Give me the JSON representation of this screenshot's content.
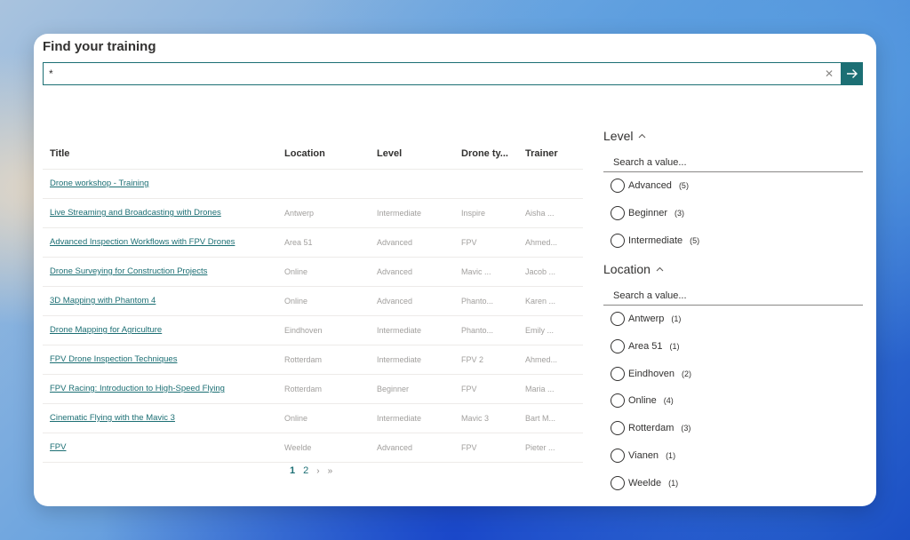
{
  "header": {
    "title": "Find your training"
  },
  "search": {
    "value": "*",
    "clear_glyph": "✕",
    "submit_icon": "arrow-right-icon"
  },
  "table": {
    "columns": [
      "Title",
      "Location",
      "Level",
      "Drone ty...",
      "Trainer"
    ],
    "rows": [
      {
        "title": "Drone workshop - Training",
        "location": "",
        "level": "",
        "drone": "",
        "trainer": ""
      },
      {
        "title": "Live Streaming and Broadcasting with Drones",
        "location": "Antwerp",
        "level": "Intermediate",
        "drone": "Inspire",
        "trainer": "Aisha ..."
      },
      {
        "title": "Advanced Inspection Workflows with FPV Drones",
        "location": "Area 51",
        "level": "Advanced",
        "drone": "FPV",
        "trainer": "Ahmed..."
      },
      {
        "title": "Drone Surveying for Construction Projects",
        "location": "Online",
        "level": "Advanced",
        "drone": "Mavic ...",
        "trainer": "Jacob ..."
      },
      {
        "title": "3D Mapping with Phantom 4",
        "location": "Online",
        "level": "Advanced",
        "drone": "Phanto...",
        "trainer": "Karen ..."
      },
      {
        "title": "Drone Mapping for Agriculture",
        "location": "Eindhoven",
        "level": "Intermediate",
        "drone": "Phanto...",
        "trainer": "Emily ..."
      },
      {
        "title": "FPV Drone Inspection Techniques",
        "location": "Rotterdam",
        "level": "Intermediate",
        "drone": "FPV 2",
        "trainer": "Ahmed..."
      },
      {
        "title": "FPV Racing: Introduction to High-Speed Flying",
        "location": "Rotterdam",
        "level": "Beginner",
        "drone": "FPV",
        "trainer": "Maria ..."
      },
      {
        "title": "Cinematic Flying with the Mavic 3",
        "location": "Online",
        "level": "Intermediate",
        "drone": "Mavic 3",
        "trainer": "Bart M..."
      },
      {
        "title": "FPV",
        "location": "Weelde",
        "level": "Advanced",
        "drone": "FPV",
        "trainer": "Pieter ..."
      }
    ]
  },
  "pagination": {
    "pages": [
      "1",
      "2"
    ],
    "current": "1",
    "next": "›",
    "last": "»"
  },
  "facets": [
    {
      "name": "Level",
      "placeholder": "Search a value...",
      "options": [
        {
          "label": "Advanced",
          "count": "(5)"
        },
        {
          "label": "Beginner",
          "count": "(3)"
        },
        {
          "label": "Intermediate",
          "count": "(5)"
        }
      ]
    },
    {
      "name": "Location",
      "placeholder": "Search a value...",
      "options": [
        {
          "label": "Antwerp",
          "count": "(1)"
        },
        {
          "label": "Area 51",
          "count": "(1)"
        },
        {
          "label": "Eindhoven",
          "count": "(2)"
        },
        {
          "label": "Online",
          "count": "(4)"
        },
        {
          "label": "Rotterdam",
          "count": "(3)"
        },
        {
          "label": "Vianen",
          "count": "(1)"
        },
        {
          "label": "Weelde",
          "count": "(1)"
        }
      ]
    }
  ],
  "colors": {
    "accent": "#1c6f74",
    "text": "#323130",
    "muted": "#a19f9d"
  }
}
